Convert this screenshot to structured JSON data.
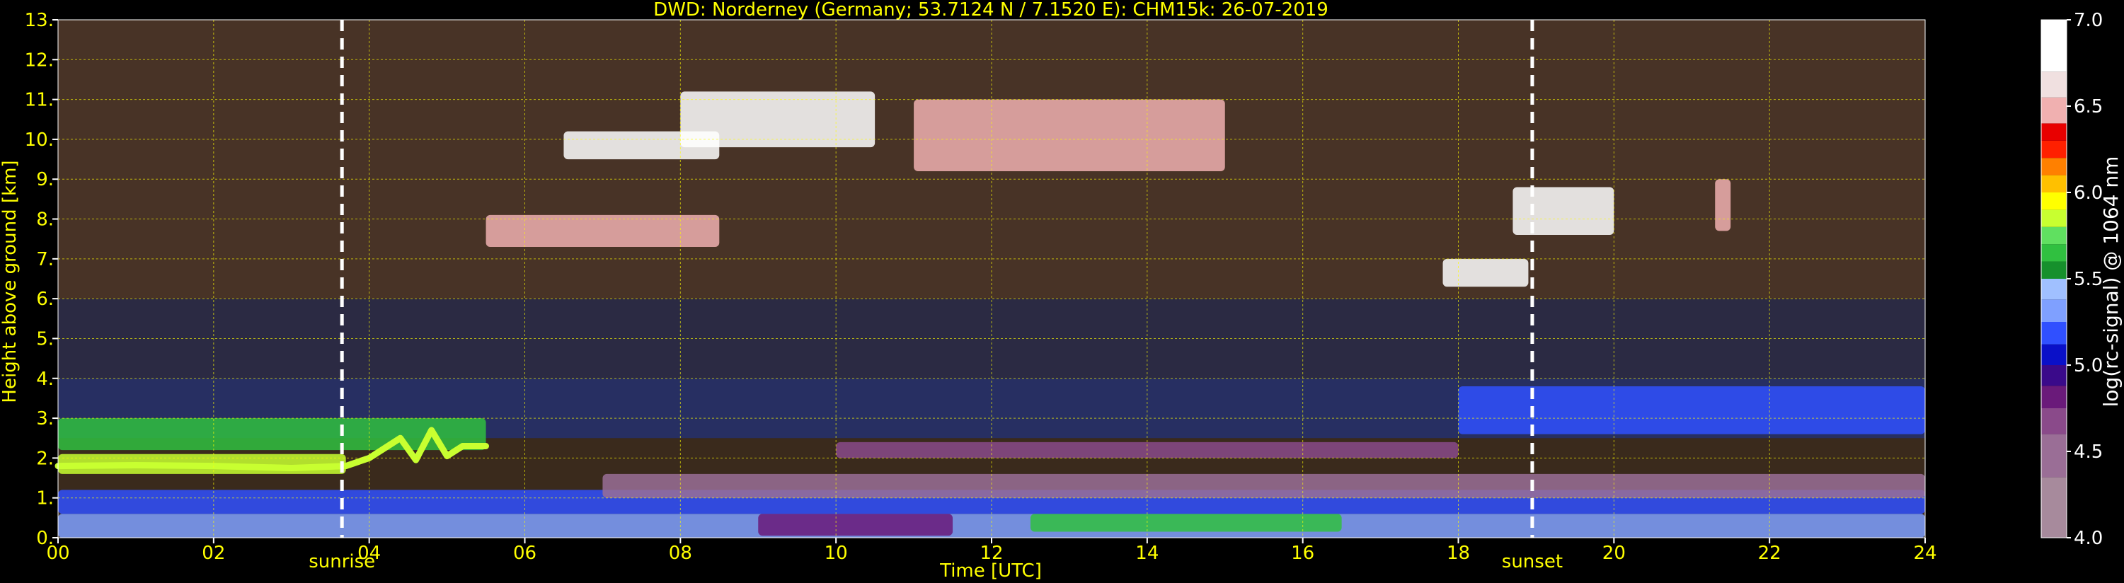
{
  "chart_data": {
    "type": "heatmap",
    "title": "DWD: Norderney (Germany; 53.7124 N / 7.1520 E):    CHM15k: 26-07-2019",
    "xlabel": "Time [UTC]",
    "ylabel": "Height above ground [km]",
    "xlim": [
      0,
      24
    ],
    "ylim": [
      0,
      13
    ],
    "x_ticks": [
      0,
      2,
      4,
      6,
      8,
      10,
      12,
      14,
      16,
      18,
      20,
      22,
      24
    ],
    "x_tick_labels": [
      "00",
      "02",
      "04",
      "06",
      "08",
      "10",
      "12",
      "14",
      "16",
      "18",
      "20",
      "22",
      "24"
    ],
    "y_ticks": [
      0,
      1,
      2,
      3,
      4,
      5,
      6,
      7,
      8,
      9,
      10,
      11,
      12,
      13
    ],
    "y_tick_labels": [
      "0.",
      "1.",
      "2.",
      "3.",
      "4.",
      "5.",
      "6.",
      "7.",
      "8.",
      "9.",
      "10.",
      "11.",
      "12.",
      "13."
    ],
    "grid": true,
    "annotations": [
      {
        "label": "sunrise",
        "x": 3.65
      },
      {
        "label": "sunset",
        "x": 18.95
      }
    ],
    "colorbar": {
      "label": "log(rc-signal) @ 1064 nm",
      "range": [
        4.0,
        7.0
      ],
      "tick_values": [
        4.0,
        4.5,
        5.0,
        5.5,
        6.0,
        6.5,
        7.0
      ],
      "tick_labels": [
        "4.0",
        "4.5",
        "5.0",
        "5.5",
        "6.0",
        "6.5",
        "7.0"
      ],
      "levels": [
        {
          "from": 4.0,
          "to": 4.35,
          "color": "#a78a9c"
        },
        {
          "from": 4.35,
          "to": 4.6,
          "color": "#9a6e96"
        },
        {
          "from": 4.6,
          "to": 4.75,
          "color": "#8a4a8a"
        },
        {
          "from": 4.75,
          "to": 4.88,
          "color": "#6a1a7a"
        },
        {
          "from": 4.88,
          "to": 5.0,
          "color": "#3a0a8a"
        },
        {
          "from": 5.0,
          "to": 5.12,
          "color": "#0a10c8"
        },
        {
          "from": 5.12,
          "to": 5.25,
          "color": "#3050ff"
        },
        {
          "from": 5.25,
          "to": 5.38,
          "color": "#7fa0ff"
        },
        {
          "from": 5.38,
          "to": 5.5,
          "color": "#a0c0ff"
        },
        {
          "from": 5.5,
          "to": 5.6,
          "color": "#16902c"
        },
        {
          "from": 5.6,
          "to": 5.7,
          "color": "#30c040"
        },
        {
          "from": 5.7,
          "to": 5.8,
          "color": "#60e060"
        },
        {
          "from": 5.8,
          "to": 5.9,
          "color": "#c8ff30"
        },
        {
          "from": 5.9,
          "to": 6.0,
          "color": "#ffff00"
        },
        {
          "from": 6.0,
          "to": 6.1,
          "color": "#ffc000"
        },
        {
          "from": 6.1,
          "to": 6.2,
          "color": "#ff8000"
        },
        {
          "from": 6.2,
          "to": 6.3,
          "color": "#ff2000"
        },
        {
          "from": 6.3,
          "to": 6.4,
          "color": "#e80000"
        },
        {
          "from": 6.4,
          "to": 6.55,
          "color": "#f0b0b0"
        },
        {
          "from": 6.55,
          "to": 6.7,
          "color": "#f0e0e0"
        },
        {
          "from": 6.7,
          "to": 7.0,
          "color": "#ffffff"
        }
      ]
    },
    "layers": [
      {
        "x0": 0,
        "x1": 24,
        "y0": 0.0,
        "y1": 0.6,
        "color": "#7fa0ff",
        "value": 5.3
      },
      {
        "x0": 9.0,
        "x1": 11.5,
        "y0": 0.05,
        "y1": 0.6,
        "color": "#6a1a7a",
        "value": 4.8
      },
      {
        "x0": 12.5,
        "x1": 16.5,
        "y0": 0.15,
        "y1": 0.6,
        "color": "#30c040",
        "value": 5.65
      },
      {
        "x0": 0,
        "x1": 24,
        "y0": 0.6,
        "y1": 1.2,
        "color": "#3050ff",
        "value": 5.2
      },
      {
        "x0": 7.0,
        "x1": 24,
        "y0": 1.0,
        "y1": 1.6,
        "color": "#9a6e96",
        "value": 4.5
      },
      {
        "x0": 0,
        "x1": 3.7,
        "y0": 1.6,
        "y1": 2.1,
        "color": "#c8ff30",
        "value": 5.85
      },
      {
        "x0": 0,
        "x1": 5.5,
        "y0": 2.2,
        "y1": 3.0,
        "color": "#30c040",
        "value": 5.65
      },
      {
        "x0": 10,
        "x1": 18,
        "y0": 2.0,
        "y1": 2.4,
        "color": "#8a4a8a",
        "value": 4.7
      },
      {
        "x0": 18,
        "x1": 24,
        "y0": 2.6,
        "y1": 3.8,
        "color": "#3050ff",
        "value": 5.2
      },
      {
        "x0": 8,
        "x1": 10.5,
        "y0": 9.8,
        "y1": 11.2,
        "color": "#ffffff",
        "value": 6.9
      },
      {
        "x0": 6.5,
        "x1": 8.5,
        "y0": 9.5,
        "y1": 10.2,
        "color": "#ffffff",
        "value": 6.9
      },
      {
        "x0": 5.5,
        "x1": 8.5,
        "y0": 7.3,
        "y1": 8.1,
        "color": "#f0b0b0",
        "value": 6.5
      },
      {
        "x0": 11,
        "x1": 15,
        "y0": 9.2,
        "y1": 11.0,
        "color": "#f0b0b0",
        "value": 6.5
      },
      {
        "x0": 18.7,
        "x1": 20,
        "y0": 7.6,
        "y1": 8.8,
        "color": "#ffffff",
        "value": 6.9
      },
      {
        "x0": 17.8,
        "x1": 18.9,
        "y0": 6.3,
        "y1": 7.0,
        "color": "#ffffff",
        "value": 6.9
      },
      {
        "x0": 21.3,
        "x1": 21.5,
        "y0": 7.7,
        "y1": 9.0,
        "color": "#f0b0b0",
        "value": 6.5
      }
    ],
    "lines": [
      {
        "name": "boundary-layer-top",
        "color": "#c8ff30",
        "points": [
          [
            0,
            1.8
          ],
          [
            1.0,
            1.82
          ],
          [
            2.0,
            1.8
          ],
          [
            3.0,
            1.75
          ],
          [
            3.7,
            1.8
          ],
          [
            4.0,
            2.0
          ],
          [
            4.4,
            2.5
          ],
          [
            4.6,
            1.95
          ],
          [
            4.8,
            2.7
          ],
          [
            5.0,
            2.05
          ],
          [
            5.2,
            2.3
          ],
          [
            5.5,
            2.3
          ]
        ]
      }
    ]
  }
}
